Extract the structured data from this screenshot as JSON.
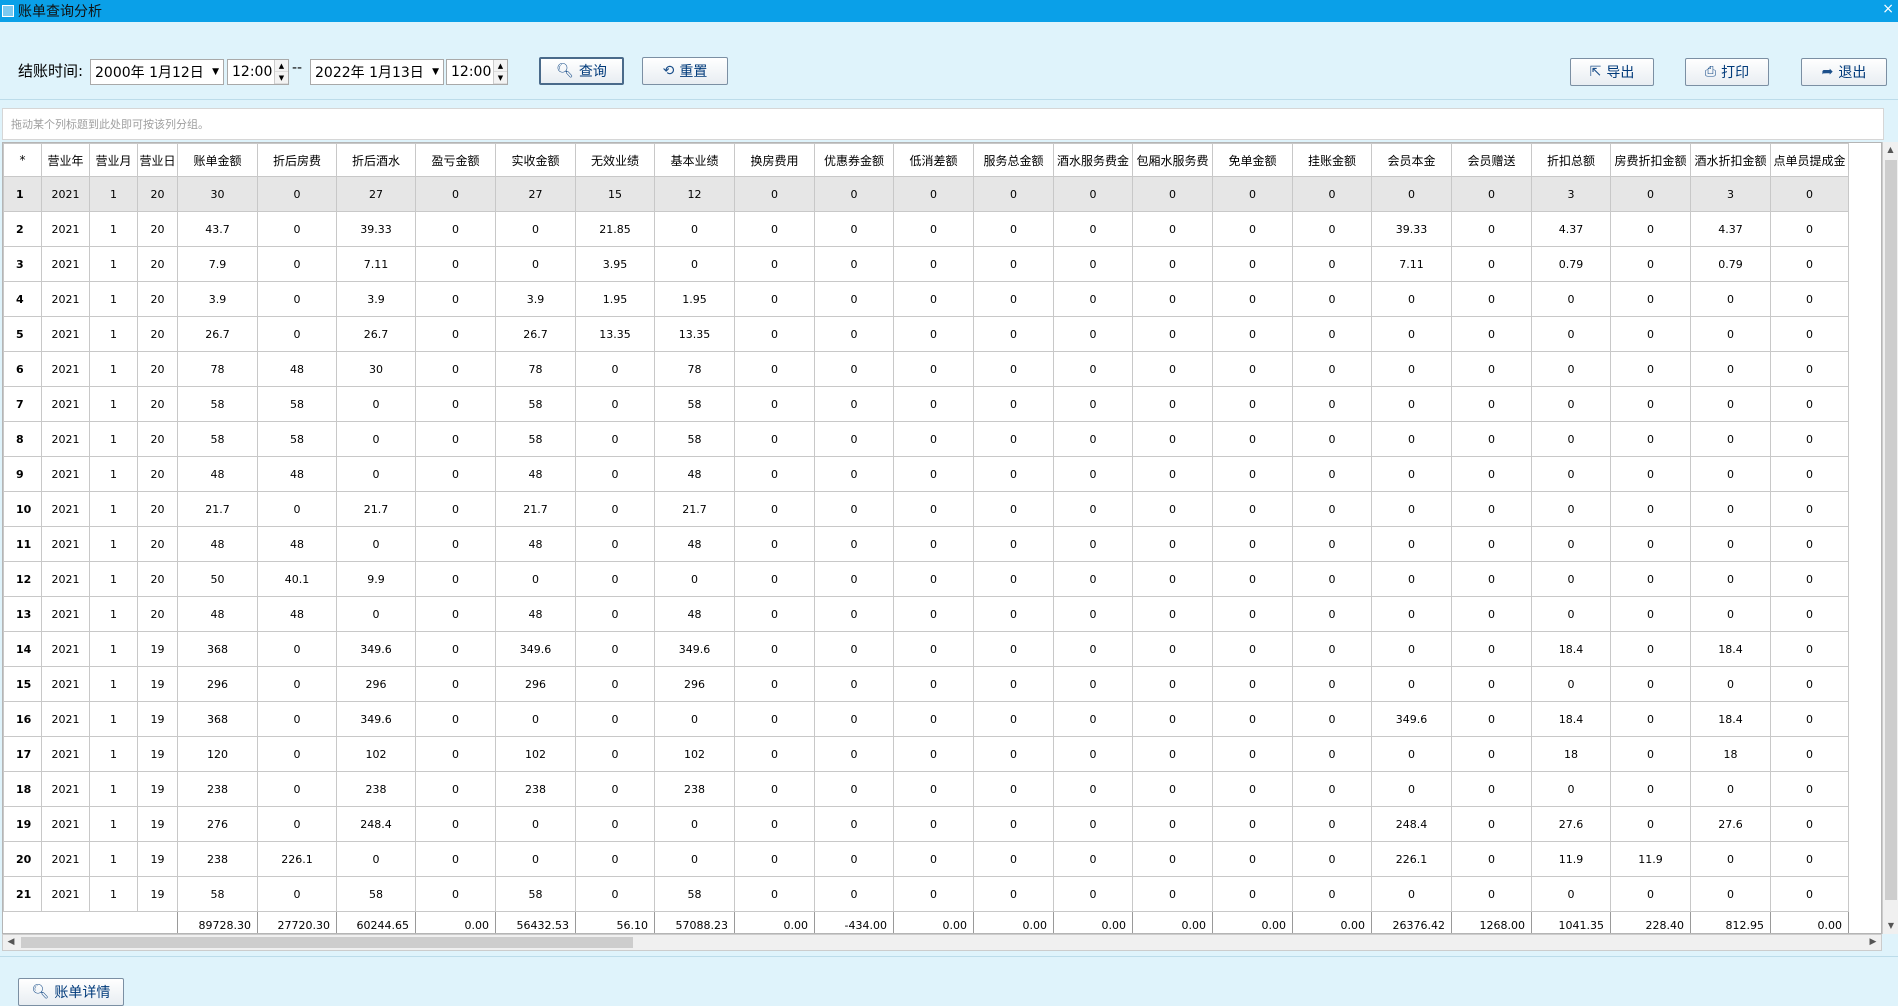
{
  "window": {
    "title": "账单查询分析",
    "close": "×"
  },
  "filter": {
    "label": "结账时间:",
    "start_date": "2000年  1月12日",
    "start_time": "12:00",
    "separator": "--",
    "end_date": "2022年  1月13日",
    "end_time": "12:00"
  },
  "buttons": {
    "query": "查询",
    "reset": "重置",
    "export": "导出",
    "print": "打印",
    "exit": "退出",
    "detail": "账单详情"
  },
  "group_hint": "拖动某个列标题到此处即可按该列分组。",
  "columns": [
    "*",
    "营业年",
    "营业月",
    "营业日",
    "账单金额",
    "折后房费",
    "折后酒水",
    "盈亏金额",
    "实收金额",
    "无效业绩",
    "基本业绩",
    "换房费用",
    "优惠券金额",
    "低消差额",
    "服务总金额",
    "酒水服务费金",
    "包厢水服务费",
    "免单金额",
    "挂账金额",
    "会员本金",
    "会员赠送",
    "折扣总额",
    "房费折扣金额",
    "酒水折扣金额",
    "点单员提成金"
  ],
  "rows": [
    [
      "1",
      "2021",
      "1",
      "20",
      "30",
      "0",
      "27",
      "0",
      "27",
      "15",
      "12",
      "0",
      "0",
      "0",
      "0",
      "0",
      "0",
      "0",
      "0",
      "0",
      "0",
      "3",
      "0",
      "3",
      "0"
    ],
    [
      "2",
      "2021",
      "1",
      "20",
      "43.7",
      "0",
      "39.33",
      "0",
      "0",
      "21.85",
      "0",
      "0",
      "0",
      "0",
      "0",
      "0",
      "0",
      "0",
      "0",
      "39.33",
      "0",
      "4.37",
      "0",
      "4.37",
      "0"
    ],
    [
      "3",
      "2021",
      "1",
      "20",
      "7.9",
      "0",
      "7.11",
      "0",
      "0",
      "3.95",
      "0",
      "0",
      "0",
      "0",
      "0",
      "0",
      "0",
      "0",
      "0",
      "7.11",
      "0",
      "0.79",
      "0",
      "0.79",
      "0"
    ],
    [
      "4",
      "2021",
      "1",
      "20",
      "3.9",
      "0",
      "3.9",
      "0",
      "3.9",
      "1.95",
      "1.95",
      "0",
      "0",
      "0",
      "0",
      "0",
      "0",
      "0",
      "0",
      "0",
      "0",
      "0",
      "0",
      "0",
      "0"
    ],
    [
      "5",
      "2021",
      "1",
      "20",
      "26.7",
      "0",
      "26.7",
      "0",
      "26.7",
      "13.35",
      "13.35",
      "0",
      "0",
      "0",
      "0",
      "0",
      "0",
      "0",
      "0",
      "0",
      "0",
      "0",
      "0",
      "0",
      "0"
    ],
    [
      "6",
      "2021",
      "1",
      "20",
      "78",
      "48",
      "30",
      "0",
      "78",
      "0",
      "78",
      "0",
      "0",
      "0",
      "0",
      "0",
      "0",
      "0",
      "0",
      "0",
      "0",
      "0",
      "0",
      "0",
      "0"
    ],
    [
      "7",
      "2021",
      "1",
      "20",
      "58",
      "58",
      "0",
      "0",
      "58",
      "0",
      "58",
      "0",
      "0",
      "0",
      "0",
      "0",
      "0",
      "0",
      "0",
      "0",
      "0",
      "0",
      "0",
      "0",
      "0"
    ],
    [
      "8",
      "2021",
      "1",
      "20",
      "58",
      "58",
      "0",
      "0",
      "58",
      "0",
      "58",
      "0",
      "0",
      "0",
      "0",
      "0",
      "0",
      "0",
      "0",
      "0",
      "0",
      "0",
      "0",
      "0",
      "0"
    ],
    [
      "9",
      "2021",
      "1",
      "20",
      "48",
      "48",
      "0",
      "0",
      "48",
      "0",
      "48",
      "0",
      "0",
      "0",
      "0",
      "0",
      "0",
      "0",
      "0",
      "0",
      "0",
      "0",
      "0",
      "0",
      "0"
    ],
    [
      "10",
      "2021",
      "1",
      "20",
      "21.7",
      "0",
      "21.7",
      "0",
      "21.7",
      "0",
      "21.7",
      "0",
      "0",
      "0",
      "0",
      "0",
      "0",
      "0",
      "0",
      "0",
      "0",
      "0",
      "0",
      "0",
      "0"
    ],
    [
      "11",
      "2021",
      "1",
      "20",
      "48",
      "48",
      "0",
      "0",
      "48",
      "0",
      "48",
      "0",
      "0",
      "0",
      "0",
      "0",
      "0",
      "0",
      "0",
      "0",
      "0",
      "0",
      "0",
      "0",
      "0"
    ],
    [
      "12",
      "2021",
      "1",
      "20",
      "50",
      "40.1",
      "9.9",
      "0",
      "0",
      "0",
      "0",
      "0",
      "0",
      "0",
      "0",
      "0",
      "0",
      "0",
      "0",
      "0",
      "0",
      "0",
      "0",
      "0",
      "0"
    ],
    [
      "13",
      "2021",
      "1",
      "20",
      "48",
      "48",
      "0",
      "0",
      "48",
      "0",
      "48",
      "0",
      "0",
      "0",
      "0",
      "0",
      "0",
      "0",
      "0",
      "0",
      "0",
      "0",
      "0",
      "0",
      "0"
    ],
    [
      "14",
      "2021",
      "1",
      "19",
      "368",
      "0",
      "349.6",
      "0",
      "349.6",
      "0",
      "349.6",
      "0",
      "0",
      "0",
      "0",
      "0",
      "0",
      "0",
      "0",
      "0",
      "0",
      "18.4",
      "0",
      "18.4",
      "0"
    ],
    [
      "15",
      "2021",
      "1",
      "19",
      "296",
      "0",
      "296",
      "0",
      "296",
      "0",
      "296",
      "0",
      "0",
      "0",
      "0",
      "0",
      "0",
      "0",
      "0",
      "0",
      "0",
      "0",
      "0",
      "0",
      "0"
    ],
    [
      "16",
      "2021",
      "1",
      "19",
      "368",
      "0",
      "349.6",
      "0",
      "0",
      "0",
      "0",
      "0",
      "0",
      "0",
      "0",
      "0",
      "0",
      "0",
      "0",
      "349.6",
      "0",
      "18.4",
      "0",
      "18.4",
      "0"
    ],
    [
      "17",
      "2021",
      "1",
      "19",
      "120",
      "0",
      "102",
      "0",
      "102",
      "0",
      "102",
      "0",
      "0",
      "0",
      "0",
      "0",
      "0",
      "0",
      "0",
      "0",
      "0",
      "18",
      "0",
      "18",
      "0"
    ],
    [
      "18",
      "2021",
      "1",
      "19",
      "238",
      "0",
      "238",
      "0",
      "238",
      "0",
      "238",
      "0",
      "0",
      "0",
      "0",
      "0",
      "0",
      "0",
      "0",
      "0",
      "0",
      "0",
      "0",
      "0",
      "0"
    ],
    [
      "19",
      "2021",
      "1",
      "19",
      "276",
      "0",
      "248.4",
      "0",
      "0",
      "0",
      "0",
      "0",
      "0",
      "0",
      "0",
      "0",
      "0",
      "0",
      "0",
      "248.4",
      "0",
      "27.6",
      "0",
      "27.6",
      "0"
    ],
    [
      "20",
      "2021",
      "1",
      "19",
      "238",
      "226.1",
      "0",
      "0",
      "0",
      "0",
      "0",
      "0",
      "0",
      "0",
      "0",
      "0",
      "0",
      "0",
      "0",
      "226.1",
      "0",
      "11.9",
      "11.9",
      "0",
      "0"
    ],
    [
      "21",
      "2021",
      "1",
      "19",
      "58",
      "0",
      "58",
      "0",
      "58",
      "0",
      "58",
      "0",
      "0",
      "0",
      "0",
      "0",
      "0",
      "0",
      "0",
      "0",
      "0",
      "0",
      "0",
      "0",
      "0"
    ]
  ],
  "totals": [
    "89728.30",
    "27720.30",
    "60244.65",
    "0.00",
    "56432.53",
    "56.10",
    "57088.23",
    "0.00",
    "-434.00",
    "0.00",
    "0.00",
    "0.00",
    "0.00",
    "0.00",
    "0.00",
    "26376.42",
    "1268.00",
    "1041.35",
    "228.40",
    "812.95",
    "0.00"
  ]
}
